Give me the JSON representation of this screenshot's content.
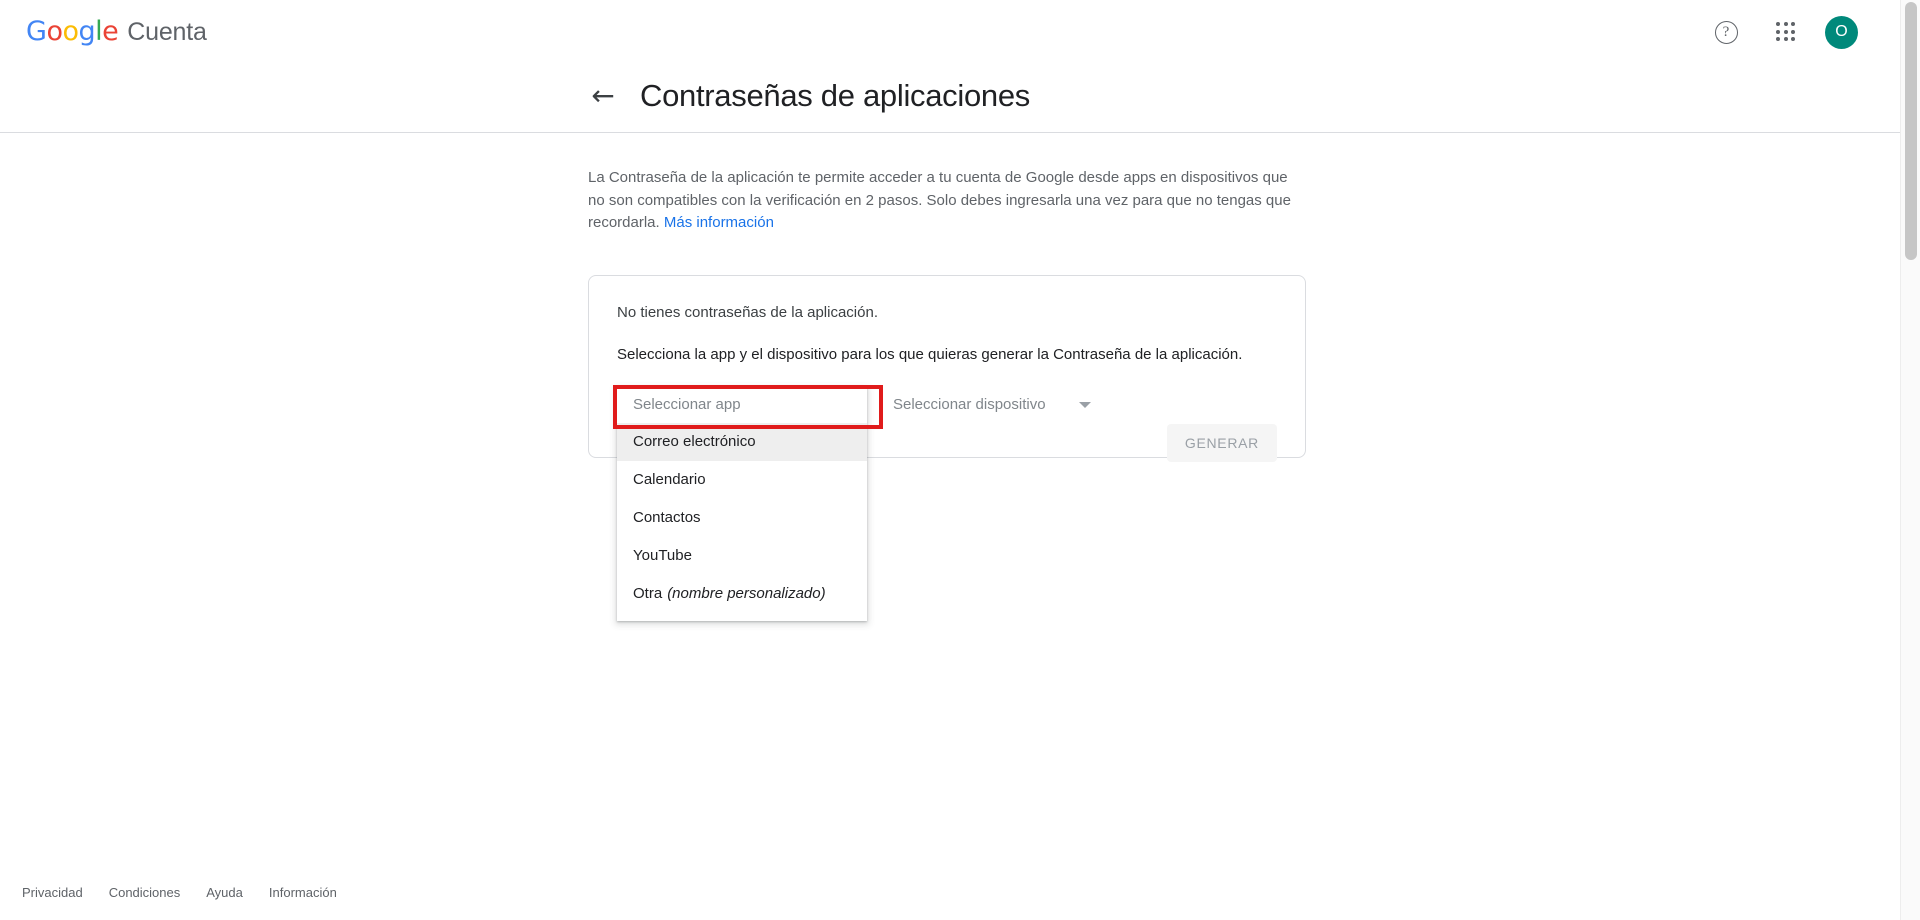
{
  "header": {
    "brand_google": "Google",
    "brand_product": "Cuenta",
    "help_glyph": "?",
    "avatar_initial": "O",
    "avatar_color": "#00897B"
  },
  "title_bar": {
    "back_arrow": "←",
    "title": "Contraseñas de aplicaciones"
  },
  "intro": {
    "text": "La Contraseña de la aplicación te permite acceder a tu cuenta de Google desde apps en dispositivos que no son compatibles con la verificación en 2 pasos. Solo debes ingresarla una vez para que no tengas que recordarla. ",
    "link_label": "Más información",
    "link_color": "#1a73e8"
  },
  "card": {
    "note": "No tienes contraseñas de la aplicación.",
    "prompt": "Selecciona la app y el dispositivo para los que quieras generar la Contraseña de la aplicación.",
    "app_select": {
      "placeholder": "Seleccionar app",
      "options": [
        {
          "label": "Correo electrónico",
          "italic": "",
          "highlighted": true
        },
        {
          "label": "Calendario",
          "italic": "",
          "highlighted": false
        },
        {
          "label": "Contactos",
          "italic": "",
          "highlighted": false
        },
        {
          "label": "YouTube",
          "italic": "",
          "highlighted": false
        },
        {
          "label": "Otra",
          "italic": "(nombre personalizado)",
          "highlighted": false
        }
      ]
    },
    "device_select": {
      "placeholder": "Seleccionar dispositivo"
    },
    "generate_button": "GENERAR",
    "highlight_color": "#e01b1b"
  },
  "footer": {
    "links": [
      "Privacidad",
      "Condiciones",
      "Ayuda",
      "Información"
    ]
  }
}
